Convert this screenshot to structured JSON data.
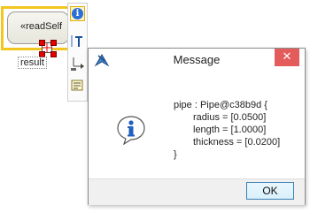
{
  "diagram": {
    "node_label": "«readSelf",
    "pin_label": "result"
  },
  "toolbar": {
    "text_icon_glyph": "T"
  },
  "dialog": {
    "title": "Message",
    "close_glyph": "✕",
    "message_lines": [
      "pipe : Pipe@c38b9d {",
      "radius = [0.0500]",
      "length = [1.0000]",
      "thickness = [0.0200]",
      "}"
    ],
    "ok_label": "OK"
  },
  "colors": {
    "selection_border": "#f2c61f",
    "close_button": "#e35b5b",
    "info_blue": "#2a6fd8",
    "ok_border": "#3c7fb1"
  },
  "icons": {
    "toolbar": [
      "info-icon",
      "text-tool-icon",
      "flow-tool-icon",
      "note-tool-icon"
    ],
    "dialog": [
      "app-icon",
      "close-icon",
      "information-icon"
    ]
  }
}
